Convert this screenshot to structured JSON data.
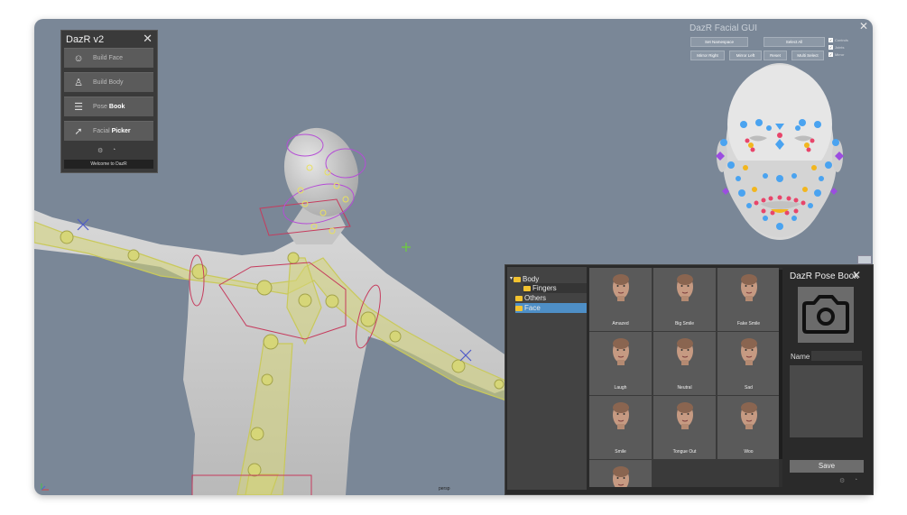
{
  "viewport": {
    "label": "persp"
  },
  "dazr": {
    "title": "DazR v2",
    "buttons": [
      {
        "icon": "face-outline-icon",
        "glyph": "☺",
        "label_plain": "Build Face",
        "label_bold": ""
      },
      {
        "icon": "body-outline-icon",
        "glyph": "♙",
        "label_plain": "Build Body",
        "label_bold": ""
      },
      {
        "icon": "pose-list-icon",
        "glyph": "☰",
        "label_plain": "Pose ",
        "label_bold": "Book"
      },
      {
        "icon": "cursor-pointer-icon",
        "glyph": "➚",
        "label_plain": "Facial ",
        "label_bold": "Picker"
      }
    ],
    "status": "Welcome to DazR"
  },
  "facial_gui": {
    "title": "DazR Facial GUI",
    "row1": [
      "Set Namespace",
      "Select All"
    ],
    "row2": [
      "Mirror Right",
      "Mirror Left",
      "Reset",
      "Multi Select"
    ],
    "checks": [
      "Controls",
      "Joints",
      "Mirror"
    ]
  },
  "tree": {
    "items": [
      {
        "label": "Body",
        "expander": "▾"
      },
      {
        "label": "Fingers",
        "expander": ""
      },
      {
        "label": "Others",
        "expander": ""
      },
      {
        "label": "Face",
        "expander": ""
      }
    ]
  },
  "poses": [
    "Amazed",
    "Big Smile",
    "Fake Smile",
    "Laugh",
    "Neutral",
    "Sad",
    "Smile",
    "Tongue Out",
    "Woo",
    ""
  ],
  "posebook": {
    "title": "DazR Pose Book",
    "name_label": "Name",
    "save_label": "Save"
  },
  "colors": {
    "viewport_bg": "#7a8797",
    "joint_yellow": "#c9c95a",
    "ctrl_blue": "#4aa3f0",
    "ctrl_red": "#e8456a",
    "ctrl_yellow": "#f2b61e",
    "ctrl_purple": "#9b4de0",
    "selection": "#4e8fc7"
  }
}
